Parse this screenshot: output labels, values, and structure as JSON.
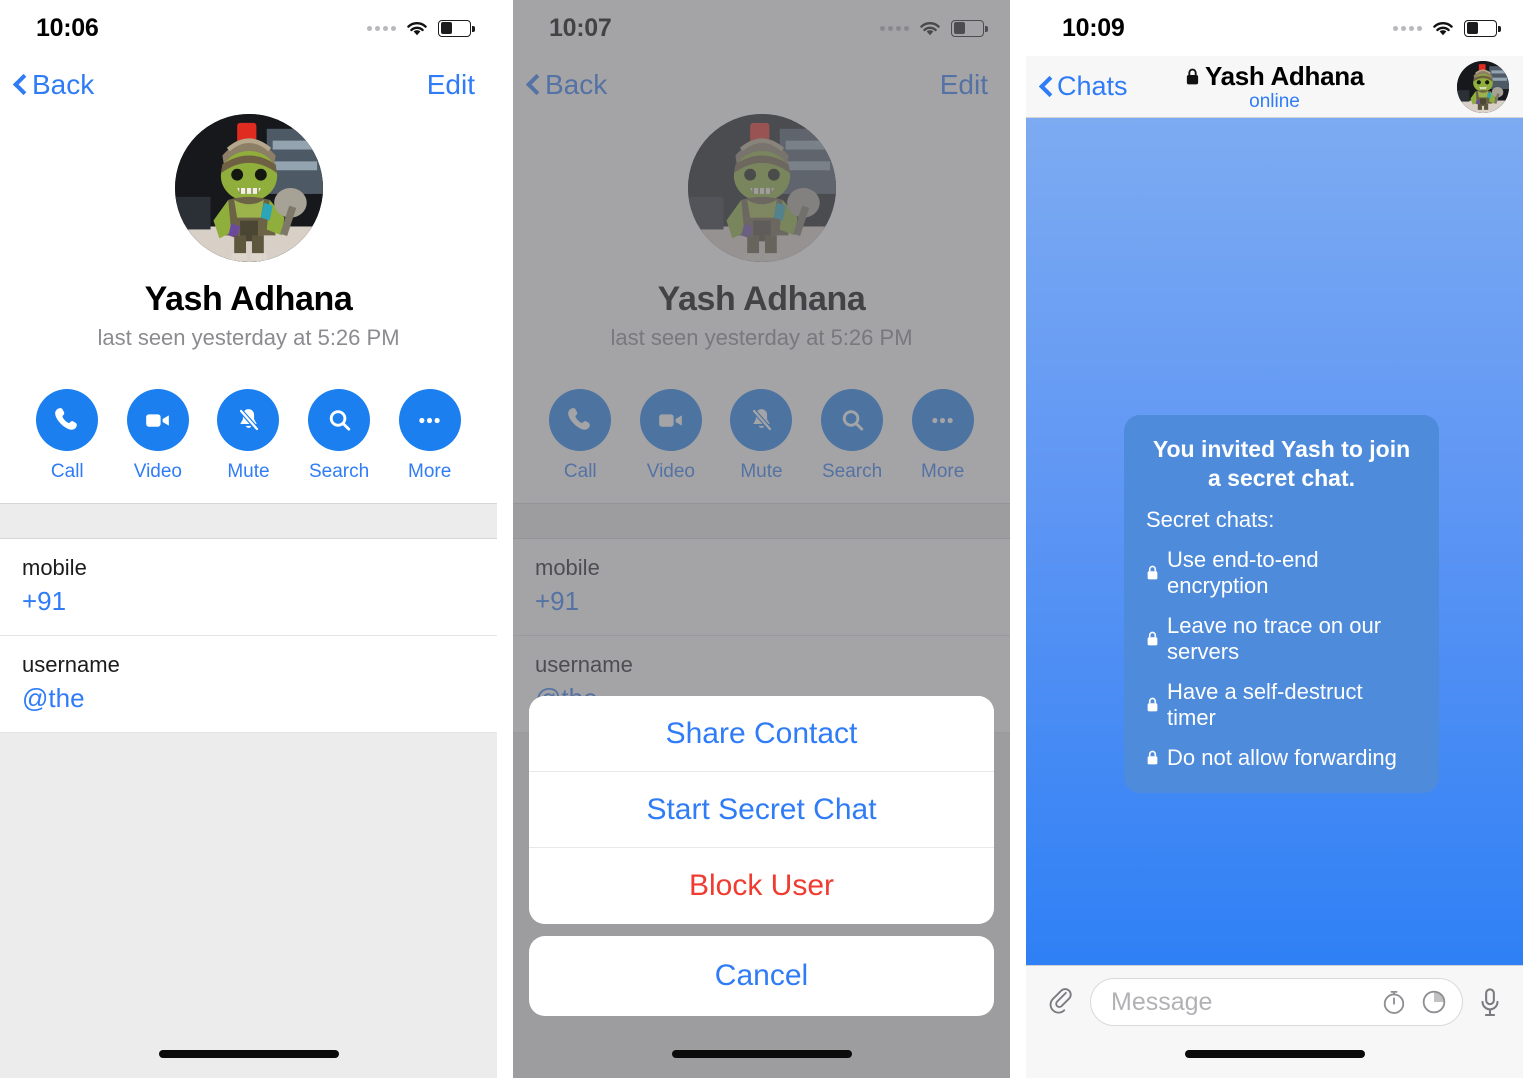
{
  "screens": [
    {
      "id": "contact-info",
      "statusbar": {
        "time": "10:06",
        "signal_icon": "signal-dots-icon",
        "wifi_icon": "wifi-icon",
        "battery_icon": "battery-icon",
        "battery_level": "40"
      },
      "nav": {
        "back_label": "Back",
        "back_icon": "chevron-left-icon",
        "edit_label": "Edit"
      },
      "profile": {
        "name": "Yash Adhana",
        "status": "last seen yesterday at 5:26 PM",
        "avatar_icon": "contact-avatar"
      },
      "actions": [
        {
          "label": "Call",
          "icon": "phone-icon"
        },
        {
          "label": "Video",
          "icon": "video-camera-icon"
        },
        {
          "label": "Mute",
          "icon": "bell-slash-icon"
        },
        {
          "label": "Search",
          "icon": "search-icon"
        },
        {
          "label": "More",
          "icon": "ellipsis-icon"
        }
      ],
      "info_rows": [
        {
          "label": "mobile",
          "value": "+91"
        },
        {
          "label": "username",
          "value": "@the"
        }
      ]
    },
    {
      "id": "contact-info-action-sheet",
      "statusbar": {
        "time": "10:07",
        "signal_icon": "signal-dots-icon",
        "wifi_icon": "wifi-icon",
        "battery_icon": "battery-icon",
        "battery_level": "40"
      },
      "nav": {
        "back_label": "Back",
        "back_icon": "chevron-left-icon",
        "edit_label": "Edit"
      },
      "profile": {
        "name": "Yash Adhana",
        "status": "last seen yesterday at 5:26 PM",
        "avatar_icon": "contact-avatar"
      },
      "actions": [
        {
          "label": "Call",
          "icon": "phone-icon"
        },
        {
          "label": "Video",
          "icon": "video-camera-icon"
        },
        {
          "label": "Mute",
          "icon": "bell-slash-icon"
        },
        {
          "label": "Search",
          "icon": "search-icon"
        },
        {
          "label": "More",
          "icon": "ellipsis-icon"
        }
      ],
      "info_rows": [
        {
          "label": "mobile",
          "value": "+91"
        },
        {
          "label": "username",
          "value": "@the"
        }
      ],
      "action_sheet": {
        "items": [
          {
            "label": "Share Contact",
            "style": "default"
          },
          {
            "label": "Start Secret Chat",
            "style": "default"
          },
          {
            "label": "Block User",
            "style": "destructive"
          }
        ],
        "cancel_label": "Cancel"
      }
    },
    {
      "id": "secret-chat",
      "statusbar": {
        "time": "10:09",
        "signal_icon": "signal-dots-icon",
        "wifi_icon": "wifi-icon",
        "battery_icon": "battery-icon",
        "battery_level": "40"
      },
      "nav": {
        "back_label": "Chats",
        "back_icon": "chevron-left-icon",
        "lock_icon": "lock-icon",
        "title": "Yash Adhana",
        "subtitle": "online",
        "avatar_icon": "contact-avatar"
      },
      "service_message": {
        "title": "You invited Yash to join a secret chat.",
        "subtitle": "Secret chats:",
        "bullets": [
          {
            "icon": "lock-icon",
            "label": "Use end-to-end encryption"
          },
          {
            "icon": "lock-icon",
            "label": "Leave no trace on our servers"
          },
          {
            "icon": "lock-icon",
            "label": "Have a self-destruct timer"
          },
          {
            "icon": "lock-icon",
            "label": "Do not allow forwarding"
          }
        ]
      },
      "input_bar": {
        "attach_icon": "paperclip-icon",
        "placeholder": "Message",
        "value": "",
        "timer_icon": "self-destruct-timer-icon",
        "sticker_icon": "sticker-icon",
        "mic_icon": "microphone-icon"
      }
    }
  ],
  "colors": {
    "accent_blue": "#2f7cf6",
    "icon_blue": "#1b7ff0",
    "destructive_red": "#ef3b30",
    "bubble_blue": "#4e8bdb",
    "chat_bg_top": "#7dabf2",
    "chat_bg_bottom": "#2f80f5",
    "dim_overlay": "#6c6c71",
    "section_gray": "#ececed"
  }
}
